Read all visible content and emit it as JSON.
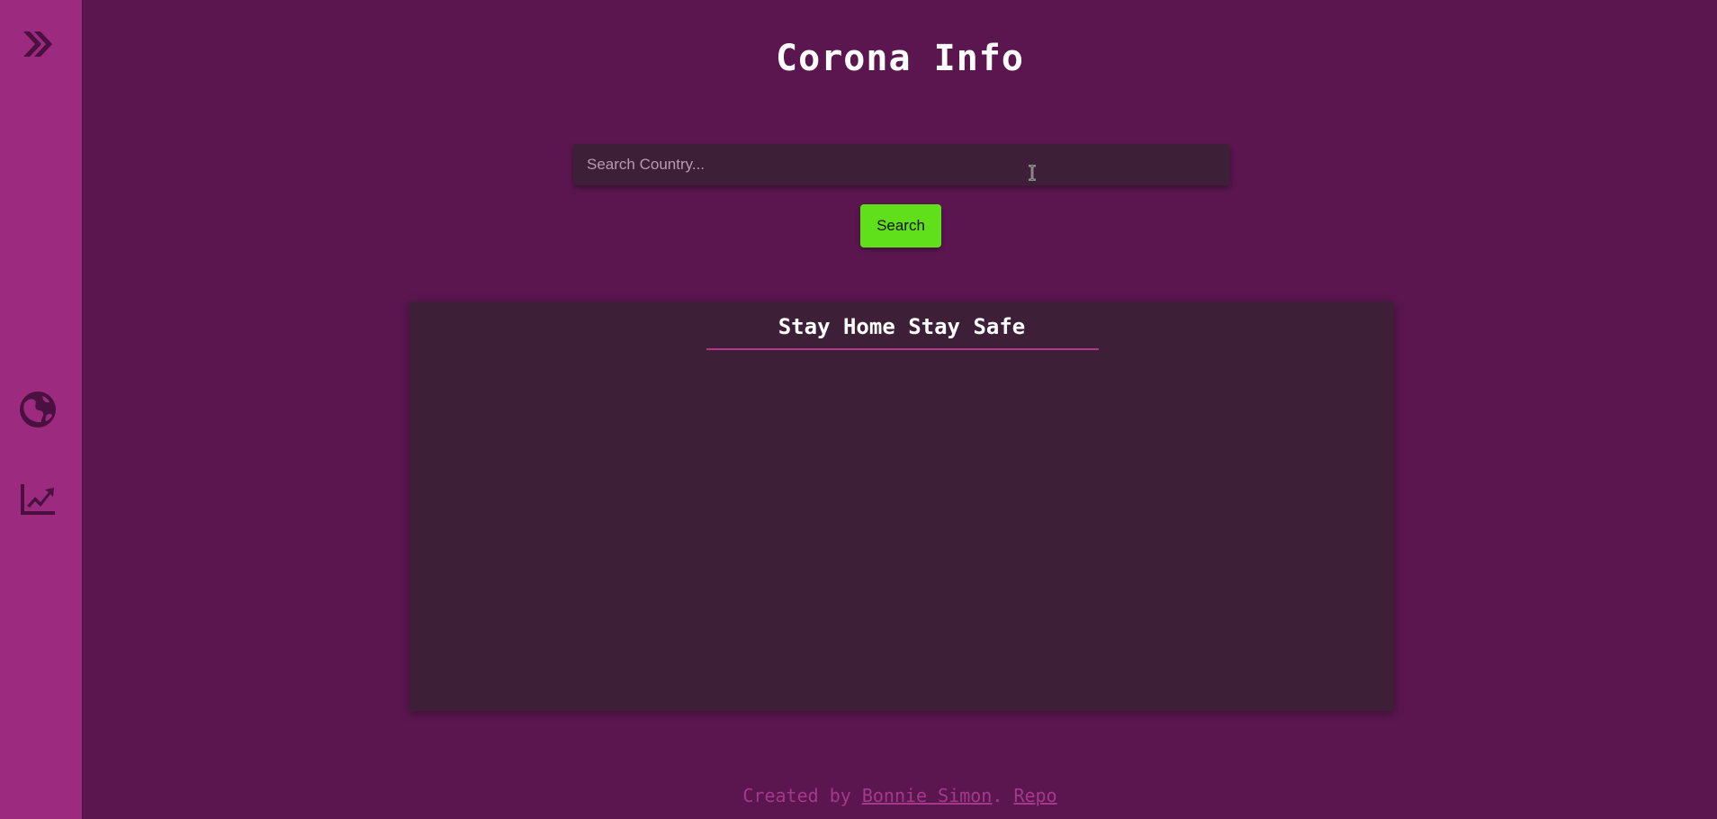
{
  "sidebar": {
    "items": [
      {
        "icon": "double-chevron-right-icon"
      },
      {
        "icon": "globe-icon"
      },
      {
        "icon": "line-chart-icon"
      }
    ]
  },
  "header": {
    "title": "Corona Info"
  },
  "search": {
    "placeholder": "Search Country...",
    "value": "",
    "button_label": "Search"
  },
  "panel": {
    "title": "Stay Home Stay Safe"
  },
  "footer": {
    "prefix": "Created by ",
    "author_link": "Bonnie Simon",
    "separator": ". ",
    "repo_link": "Repo"
  },
  "colors": {
    "background": "#5b1650",
    "sidebar": "#9c2a7f",
    "panel": "#3e1f38",
    "accent": "#b2358f",
    "button": "#5fe01a",
    "icon": "#4a1040"
  }
}
